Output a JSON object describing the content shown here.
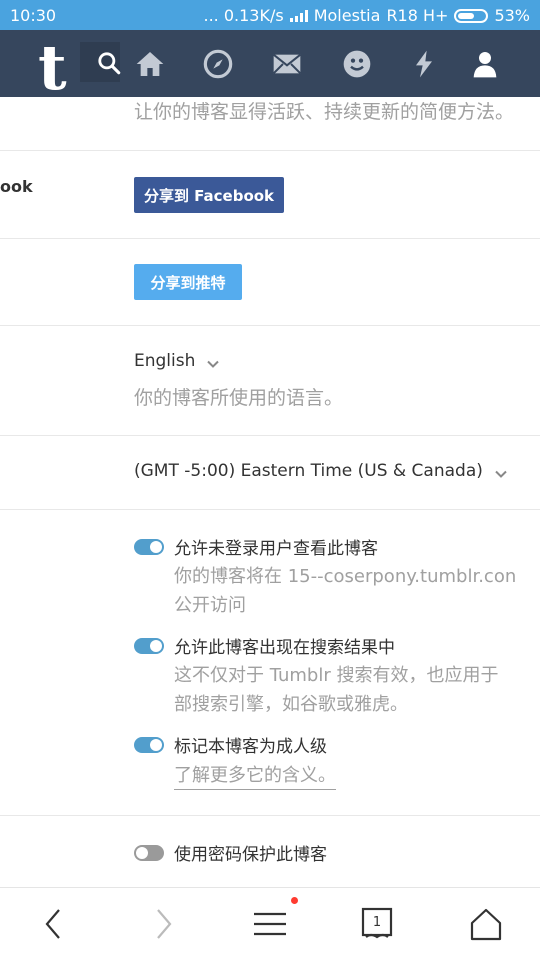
{
  "status": {
    "time": "10:30",
    "speed": "... 0.13K/s",
    "carrier": "Molestia",
    "network": "R18 H+",
    "battery": "53%"
  },
  "nav": {
    "logo": "t",
    "icons": [
      "search-icon",
      "home-icon",
      "compass-icon",
      "mail-icon",
      "smiley-icon",
      "lightning-icon",
      "user-icon"
    ]
  },
  "content": {
    "top_desc": "让你的博客显得活跃、持续更新的简便方法。",
    "facebook_left_label": "ook",
    "facebook_button": "分享到 Facebook",
    "twitter_button": "分享到推特",
    "language_value": "English",
    "language_desc": "你的博客所使用的语言。",
    "timezone_value": "(GMT -5:00) Eastern Time (US & Canada)",
    "toggles": [
      {
        "label": "允许未登录用户查看此博客",
        "desc1": "你的博客将在 15--coserpony.tumblr.con",
        "desc2": "公开访问",
        "on": true
      },
      {
        "label": "允许此博客出现在搜索结果中",
        "desc1": "这不仅对于 Tumblr 搜索有效，也应用于",
        "desc2": "部搜索引擎，如谷歌或雅虎。",
        "on": true
      },
      {
        "label": "标记本博客为成人级",
        "link": "了解更多它的含义。",
        "on": true
      },
      {
        "label": "使用密码保护此博客",
        "on": false
      }
    ]
  },
  "bottom": {
    "tab_count": "1",
    "icons": [
      "back-icon",
      "forward-icon",
      "menu-icon",
      "tabs-icon",
      "home-outline-icon"
    ]
  },
  "colors": {
    "status_bar": "#4aa3df",
    "nav_bar": "#36465d",
    "facebook": "#3b5998",
    "twitter": "#55acee",
    "toggle_on": "#529ecc"
  }
}
